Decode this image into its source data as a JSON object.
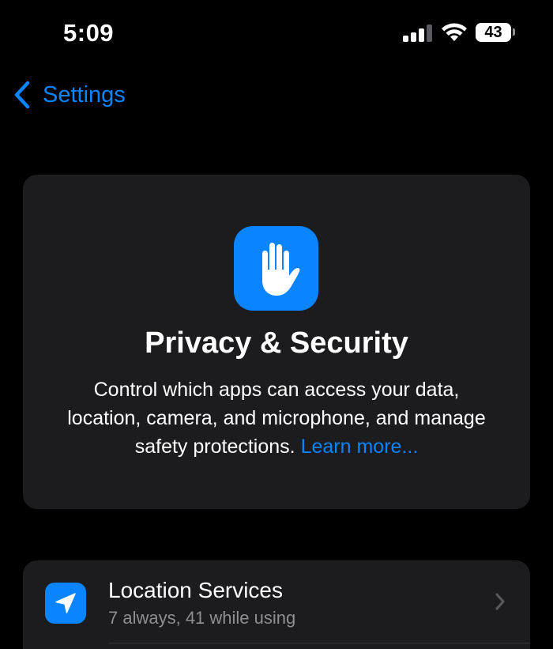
{
  "status_bar": {
    "time": "5:09",
    "battery_level": "43"
  },
  "nav": {
    "back_label": "Settings"
  },
  "header": {
    "icon": "raised-hand-icon",
    "title": "Privacy & Security",
    "description": "Control which apps can access your data, location, camera, and microphone, and manage safety protections.",
    "learn_more": "Learn more..."
  },
  "rows": [
    {
      "icon": "location-arrow-icon",
      "title": "Location Services",
      "subtitle": "7 always, 41 while using"
    }
  ],
  "colors": {
    "accent": "#0a84ff",
    "card_background": "#1c1c1e",
    "background": "#000000",
    "secondary_text": "#8e8e93"
  }
}
